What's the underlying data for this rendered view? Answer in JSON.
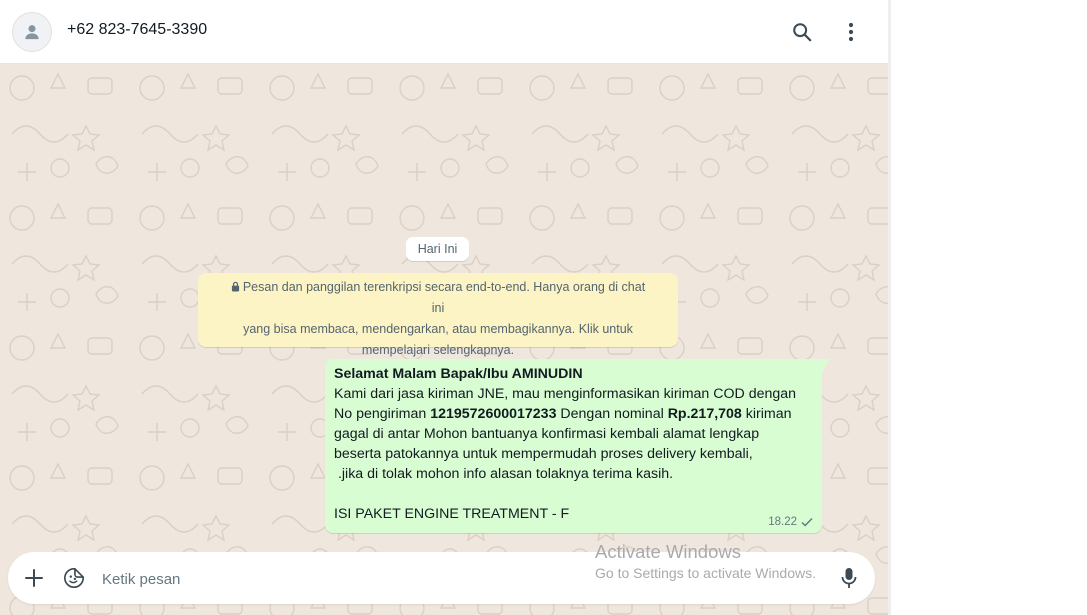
{
  "header": {
    "contact_name": "+62 823-7645-3390",
    "icons": [
      "default-avatar-icon",
      "search-icon",
      "menu-dots-icon"
    ]
  },
  "chat": {
    "date_label": "Hari Ini",
    "encryption_notice": "Pesan dan panggilan terenkripsi secara end-to-end. Hanya orang di chat ini yang bisa membaca, mendengarkan, atau membagikannya. Klik untuk mempelajari selengkapnya.",
    "encryption_lines": [
      "Pesan dan panggilan terenkripsi secara end-to-end. Hanya orang di chat ini",
      "yang bisa membaca, mendengarkan, atau membagikannya. Klik untuk",
      "mempelajari selengkapnya."
    ],
    "message": {
      "greeting": "Selamat Malam Bapak/Ibu AMINUDIN",
      "line1": "Kami dari jasa kiriman JNE, mau menginformasikan kiriman COD dengan",
      "line2_prefix": "No pengiriman ",
      "tracking_number": "1219572600017233",
      "line2_middle": " Dengan nominal ",
      "amount": "Rp.217,708",
      "line2_suffix": " kiriman",
      "line3": "gagal di antar Mohon bantuanya konfirmasi kembali alamat lengkap",
      "line4": "beserta patokannya untuk mempermudah proses delivery kembali,",
      "line5": " .jika di tolak mohon info alasan tolaknya terima kasih.",
      "line6": "ISI PAKET ENGINE TREATMENT - F",
      "time": "18.22",
      "status": "sent-check-icon"
    }
  },
  "composer": {
    "placeholder": "Ketik pesan",
    "value": "",
    "icons": [
      "plus-icon",
      "sticker-icon",
      "mic-icon"
    ]
  },
  "watermark": {
    "title": "Activate Windows",
    "subtitle": "Go to Settings to activate Windows."
  },
  "colors": {
    "chat_bg": "#efe7de",
    "outgoing_bubble": "#d9fdd3",
    "notice_bg": "#fdf4c5",
    "header_bg": "#ffffff"
  }
}
